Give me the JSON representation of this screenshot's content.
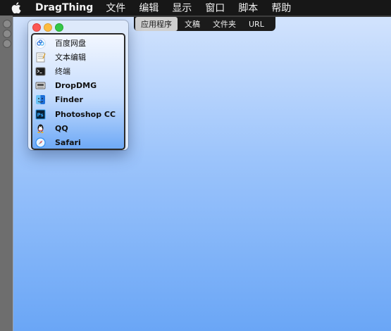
{
  "menubar": {
    "apple_icon": "apple-logo-icon",
    "app_name": "DragThing",
    "items": [
      "文件",
      "编辑",
      "显示",
      "窗口",
      "脚本",
      "帮助"
    ]
  },
  "tabs": [
    {
      "label": "应用程序",
      "active": true
    },
    {
      "label": "文稿",
      "active": false
    },
    {
      "label": "文件夹",
      "active": false
    },
    {
      "label": "URL",
      "active": false
    }
  ],
  "apps": [
    {
      "label": "百度网盘",
      "icon": "baidu-netdisk-icon"
    },
    {
      "label": "文本编辑",
      "icon": "textedit-icon"
    },
    {
      "label": "终端",
      "icon": "terminal-icon"
    },
    {
      "label": "DropDMG",
      "icon": "dropdmg-icon"
    },
    {
      "label": "Finder",
      "icon": "finder-icon"
    },
    {
      "label": "Photoshop CC",
      "icon": "photoshop-icon"
    },
    {
      "label": "QQ",
      "icon": "qq-icon"
    },
    {
      "label": "Safari",
      "icon": "safari-icon"
    }
  ],
  "colors": {
    "menubar": "#171717",
    "drawer_top": "#d2e3fd",
    "drawer_bottom": "#6aa6f6",
    "close": "#fc5753",
    "minimize": "#fdbc40",
    "zoom": "#33c748"
  }
}
